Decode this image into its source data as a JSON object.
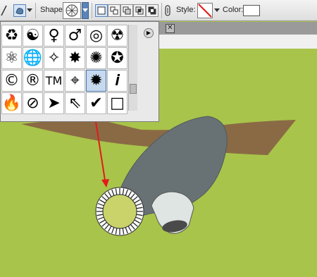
{
  "toolbar": {
    "shape_label": "Shape:",
    "style_label": "Style:",
    "color_label": "Color:",
    "color_value": "#ffffff"
  },
  "shape_picker": {
    "selected": "Radial starburst",
    "cells": [
      {
        "name": "recycle-icon",
        "glyph": "♻"
      },
      {
        "name": "yin-yang-icon",
        "glyph": "☯"
      },
      {
        "name": "female-icon",
        "glyph": "♀"
      },
      {
        "name": "male-icon",
        "glyph": "♂"
      },
      {
        "name": "target-icon",
        "glyph": "◎"
      },
      {
        "name": "radiation-icon",
        "glyph": "☢"
      },
      {
        "name": "atom-icon",
        "glyph": "⚛"
      },
      {
        "name": "globe-icon",
        "glyph": "🌐"
      },
      {
        "name": "sparkle-icon",
        "glyph": "✧"
      },
      {
        "name": "burst-icon",
        "glyph": "✸"
      },
      {
        "name": "burst-outline-icon",
        "glyph": "✺"
      },
      {
        "name": "star-icon",
        "glyph": "✪"
      },
      {
        "name": "copyright-icon",
        "glyph": "©"
      },
      {
        "name": "registered-icon",
        "glyph": "®"
      },
      {
        "name": "trademark-icon",
        "glyph": "TM"
      },
      {
        "name": "crosshair-icon",
        "glyph": "⌖"
      },
      {
        "name": "starburst-circle-icon",
        "glyph": "✹"
      },
      {
        "name": "info-icon",
        "glyph": "𝒊"
      },
      {
        "name": "fire-icon",
        "glyph": "🔥"
      },
      {
        "name": "no-symbol-icon",
        "glyph": "⊘"
      },
      {
        "name": "arrow-cursor-icon",
        "glyph": "➤"
      },
      {
        "name": "arrow-cursor-outline-icon",
        "glyph": "⇖"
      },
      {
        "name": "checkmark-icon",
        "glyph": "✔"
      },
      {
        "name": "blank-square-icon",
        "glyph": "□"
      }
    ]
  },
  "colors": {
    "background": "#a9c44a",
    "ground_brown": "#8a6a45",
    "blade_gray": "#687275",
    "hub_light": "#dfe5e2",
    "pointer_red": "#e11b1b"
  }
}
